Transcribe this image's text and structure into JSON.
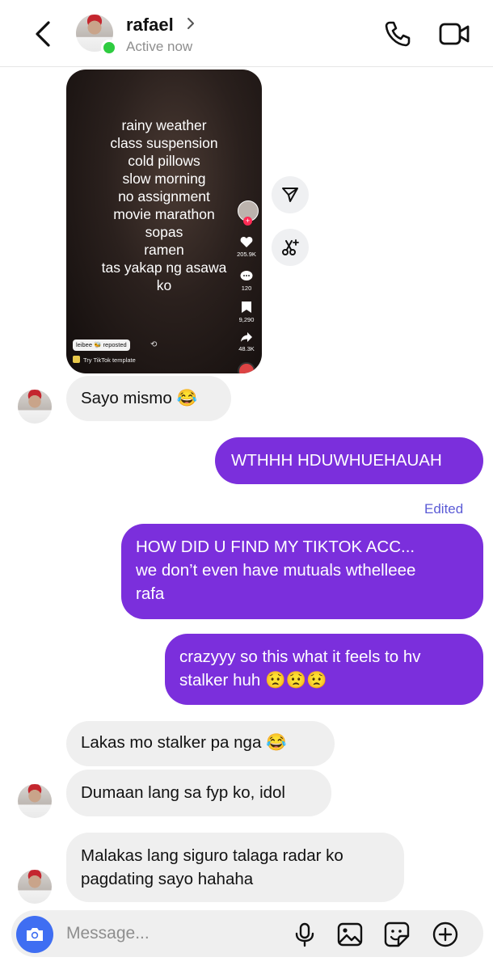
{
  "header": {
    "contact_name": "rafael",
    "status": "Active now"
  },
  "shared_post": {
    "overlay_lines": [
      "rainy weather",
      "class suspension",
      "cold pillows",
      "slow morning",
      "no assignment",
      "movie marathon",
      "sopas",
      "ramen",
      "tas yakap ng asawa",
      "ko"
    ],
    "likes": "205.9K",
    "comments": "120",
    "saves": "9,290",
    "shares": "48.3K",
    "repost_label": "leibee 🐝 reposted",
    "template_label": "Try TikTok template"
  },
  "messages": [
    {
      "sender": "rafael",
      "text": "Sayo mismo 😂"
    },
    {
      "sender": "me",
      "text": "WTHHH HDUWHUEHAUAH"
    },
    {
      "sender": "me",
      "edited_label": "Edited",
      "lines": [
        "HOW DID U FIND MY TIKTOK ACC...",
        "we don’t even have mutuals wthelleee",
        "rafa"
      ]
    },
    {
      "sender": "me",
      "lines": [
        "crazyyy so this what it feels to hv",
        "stalker huh 😟😟😟"
      ]
    },
    {
      "sender": "rafael",
      "text": "Lakas mo stalker pa nga 😂"
    },
    {
      "sender": "rafael",
      "text": "Dumaan lang sa fyp ko, idol"
    },
    {
      "sender": "rafael",
      "lines": [
        "Malakas lang siguro talaga radar ko",
        "pagdating sayo hahaha"
      ]
    }
  ],
  "composer": {
    "placeholder": "Message..."
  },
  "icons": {
    "back": "chevron-left-icon",
    "call": "phone-icon",
    "video": "video-camera-icon",
    "share": "paper-plane-icon",
    "remix": "scissors-sparkle-icon",
    "camera": "camera-icon",
    "mic": "microphone-icon",
    "gallery": "image-icon",
    "sticker": "sticker-icon",
    "add": "plus-circle-icon"
  },
  "colors": {
    "outgoing_bubble": "#7b2fdc",
    "incoming_bubble": "#efefef",
    "online": "#2ecc40",
    "camera_button": "#3f6ef2",
    "edited_label": "#5b5bd6"
  }
}
